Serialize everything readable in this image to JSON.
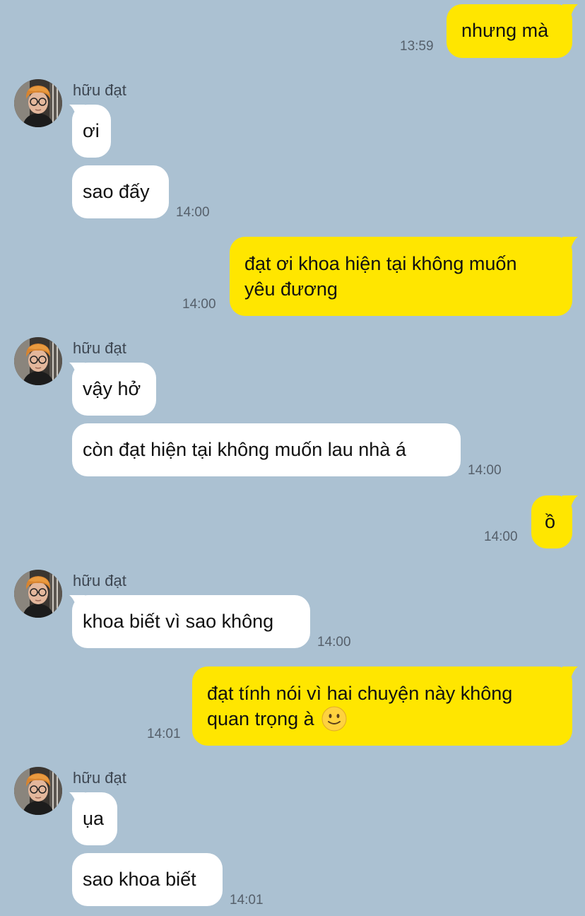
{
  "contact": {
    "name": "hữu đạt"
  },
  "colors": {
    "background": "#abc1d2",
    "outgoing_bubble": "#ffe600",
    "incoming_bubble": "#ffffff"
  },
  "messages": [
    {
      "from": "me",
      "text": "nhưng mà",
      "time": "13:59"
    },
    {
      "from": "contact",
      "sender": "hữu đạt",
      "text": "ơi"
    },
    {
      "from": "contact",
      "text": "sao đấy",
      "time": "14:00"
    },
    {
      "from": "me",
      "lines": [
        "đạt ơi khoa hiện tại không muốn",
        "yêu đương"
      ],
      "time": "14:00"
    },
    {
      "from": "contact",
      "sender": "hữu đạt",
      "text": "vậy hở"
    },
    {
      "from": "contact",
      "text": "còn đạt hiện tại không muốn lau nhà á",
      "time": "14:00"
    },
    {
      "from": "me",
      "text": "ồ",
      "time": "14:00"
    },
    {
      "from": "contact",
      "sender": "hữu đạt",
      "text": "khoa biết vì sao không",
      "time": "14:00"
    },
    {
      "from": "me",
      "lines": [
        "đạt tính nói vì hai chuyện này không",
        "quan trọng à"
      ],
      "emoji": "slightly-smiling-face",
      "time": "14:01"
    },
    {
      "from": "contact",
      "sender": "hữu đạt",
      "text": "ụa"
    },
    {
      "from": "contact",
      "text": "sao khoa biết",
      "time": "14:01"
    }
  ]
}
